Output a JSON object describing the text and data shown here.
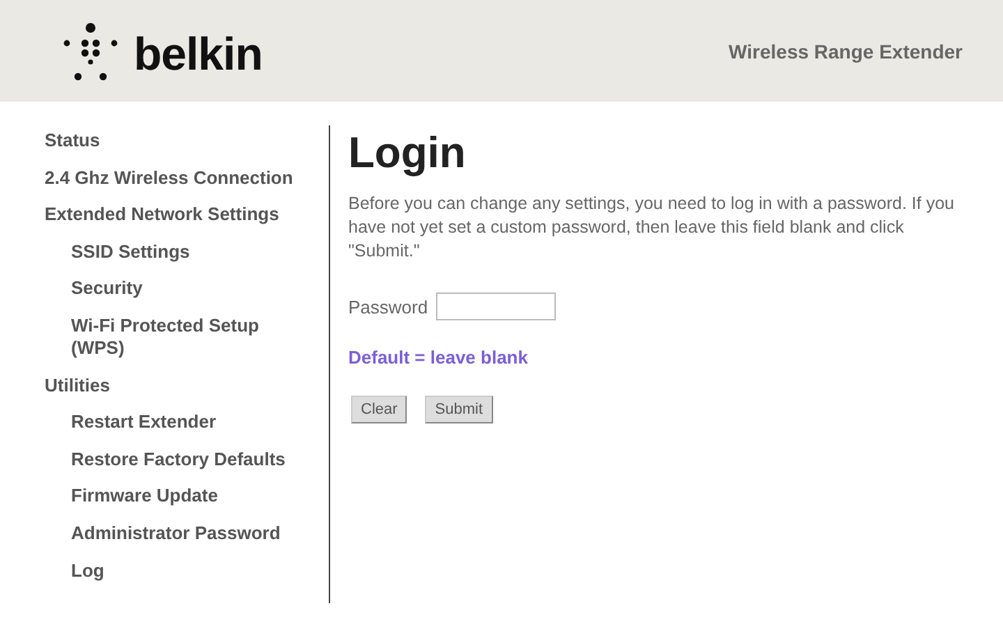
{
  "header": {
    "logo_text": "belkin",
    "product": "Wireless Range Extender"
  },
  "sidebar": {
    "items": [
      {
        "label": "Status"
      },
      {
        "label": "2.4 Ghz Wireless Connection"
      },
      {
        "label": "Extended Network Settings",
        "children": [
          {
            "label": "SSID Settings"
          },
          {
            "label": "Security"
          },
          {
            "label": "Wi-Fi Protected Setup (WPS)"
          }
        ]
      },
      {
        "label": "Utilities",
        "children": [
          {
            "label": "Restart Extender"
          },
          {
            "label": "Restore Factory Defaults"
          },
          {
            "label": "Firmware Update"
          },
          {
            "label": "Administrator Password"
          },
          {
            "label": "Log"
          }
        ]
      }
    ]
  },
  "main": {
    "title": "Login",
    "intro": "Before you can change any settings, you need to log in with a password. If you have not yet set a custom password, then leave this field blank and click \"Submit.\"",
    "password_label": "Password",
    "hint": "Default = leave blank",
    "buttons": [
      "Clear",
      "Submit"
    ]
  }
}
